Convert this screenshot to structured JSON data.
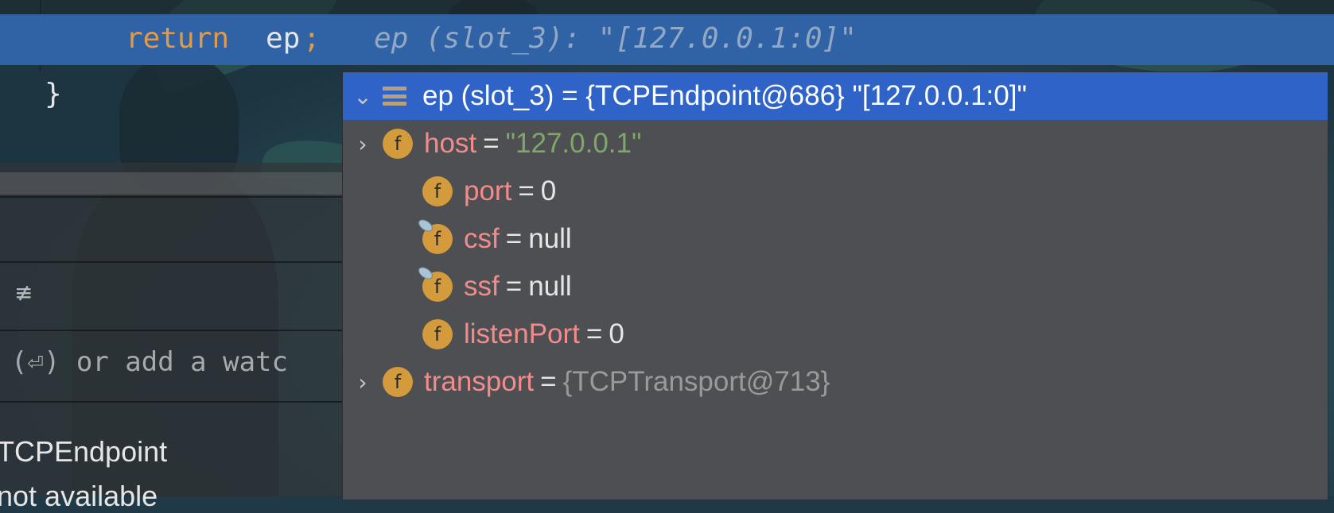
{
  "editor": {
    "code_keyword": "return",
    "code_variable": "ep",
    "code_semicolon": ";",
    "inline_hint": "ep (slot_3): \"[127.0.0.1:0]\"",
    "closing_brace": "}"
  },
  "left_panel": {
    "layout_icon": "≢",
    "hint_text": "(⏎) or add a watc",
    "variable_row_1": "TCPEndpoint",
    "variable_row_2": "not available"
  },
  "popup": {
    "root": {
      "label": "ep (slot_3) = {TCPEndpoint@686} \"[127.0.0.1:0]\"",
      "expanded": true,
      "icon": "object-icon"
    },
    "fields": [
      {
        "name": "host",
        "equals": "=",
        "value": "\"127.0.0.1\"",
        "value_type": "string",
        "expandable": true,
        "transient": false
      },
      {
        "name": "port",
        "equals": "=",
        "value": "0",
        "value_type": "number",
        "expandable": false,
        "transient": false
      },
      {
        "name": "csf",
        "equals": "=",
        "value": "null",
        "value_type": "null",
        "expandable": false,
        "transient": true
      },
      {
        "name": "ssf",
        "equals": "=",
        "value": "null",
        "value_type": "null",
        "expandable": false,
        "transient": true
      },
      {
        "name": "listenPort",
        "equals": "=",
        "value": "0",
        "value_type": "number",
        "expandable": false,
        "transient": false
      },
      {
        "name": "transport",
        "equals": "=",
        "value": "{TCPTransport@713}",
        "value_type": "reference",
        "expandable": true,
        "transient": false
      }
    ],
    "field_icon_letter": "f",
    "expand_glyph": "›",
    "collapse_glyph": "⌄"
  },
  "colors": {
    "execution_line": "#2f63a6",
    "selected_row": "#2f63c8",
    "popup_background": "#4e4f52",
    "field_name": "#f28b8b",
    "string_value": "#7fa76a",
    "reference_value": "#9a9a9a",
    "keyword": "#e09a4b",
    "field_icon": "#d39b3c"
  }
}
